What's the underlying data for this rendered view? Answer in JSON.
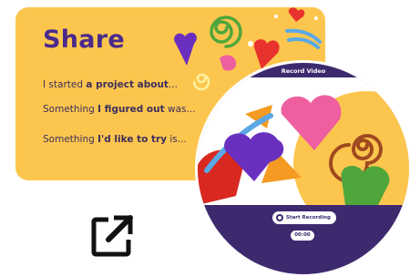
{
  "share_card": {
    "title": "Share",
    "prompt1": {
      "before": "I started ",
      "bold": "a project about",
      "after": "..."
    },
    "prompt2": {
      "before": "Something ",
      "bold": "I figured out",
      "after": " was..."
    },
    "prompt3": {
      "before": "Something ",
      "bold": "I'd like to try",
      "after": " is..."
    }
  },
  "recorder": {
    "title": "Record Video",
    "start_label": "Start Recording",
    "timer": "00:00"
  },
  "icons": {
    "external_link": "external-link-icon",
    "record": "record-icon"
  },
  "colors": {
    "card_bg": "#fcc64e",
    "accent_purple": "#4b2a8c",
    "recorder_bg": "#3d2a6e"
  }
}
